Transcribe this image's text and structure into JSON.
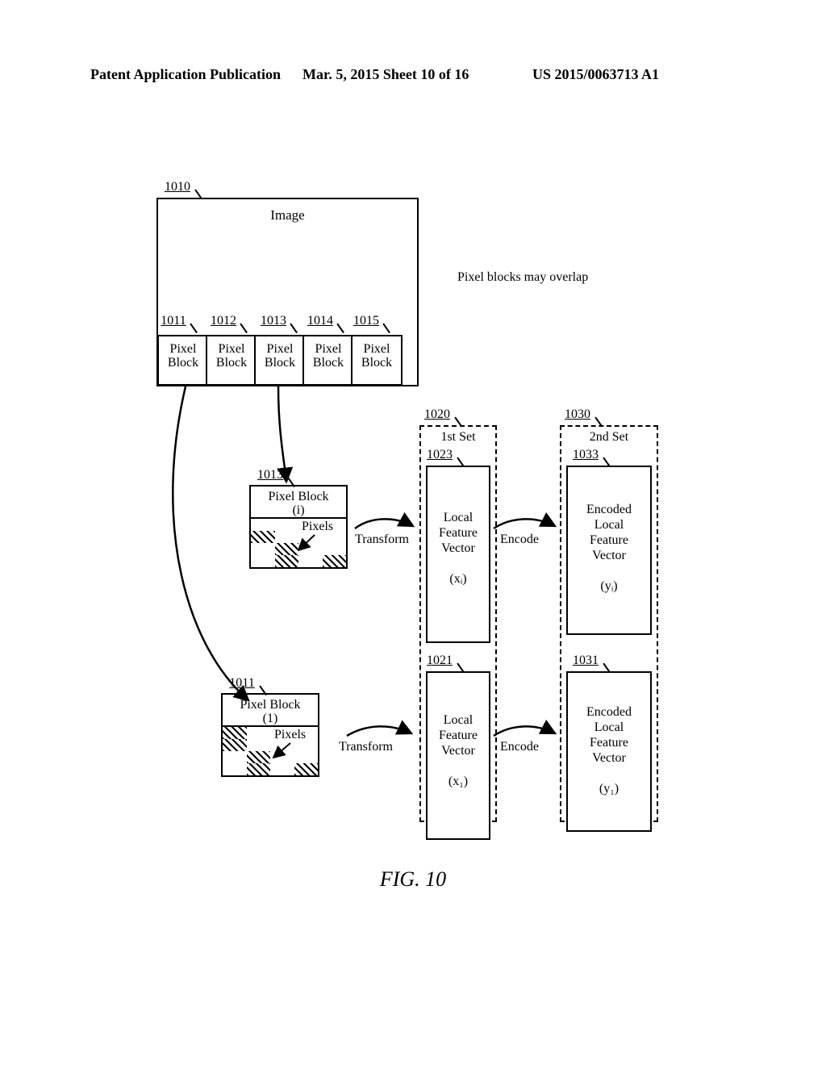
{
  "header": {
    "left": "Patent Application Publication",
    "mid": "Mar. 5, 2015  Sheet 10 of 16",
    "right": "US 2015/0063713 A1"
  },
  "annotations": {
    "overlap_note": "Pixel blocks may overlap",
    "pixels_label_i": "Pixels",
    "pixels_label_1": "Pixels",
    "transform_i": "Transform",
    "transform_1": "Transform",
    "encode_i": "Encode",
    "encode_1": "Encode"
  },
  "refs": {
    "image": "1010",
    "pb1": "1011",
    "pb2": "1012",
    "pb3": "1013",
    "pb4": "1014",
    "pb5": "1015",
    "set1": "1020",
    "lfv_i": "1023",
    "set2": "1030",
    "elfv_i": "1033",
    "pbi": "1013",
    "lfv_1": "1021",
    "elfv_1": "1031",
    "pb1b": "1011"
  },
  "boxes": {
    "image_title": "Image",
    "pb": "Pixel\nBlock",
    "pbi": "Pixel Block\n(i)",
    "pb1": "Pixel Block\n(1)",
    "set1": "1st Set",
    "set2": "2nd Set",
    "lfv_i": "Local\nFeature\nVector\n\n(xᵢ)",
    "lfv_1": "Local\nFeature\nVector\n\n(x₁)",
    "elfv_i": "Encoded\nLocal\nFeature\nVector\n\n(yᵢ)",
    "elfv_1": "Encoded\nLocal\nFeature\nVector\n\n(y₁)"
  },
  "caption": "FIG. 10"
}
